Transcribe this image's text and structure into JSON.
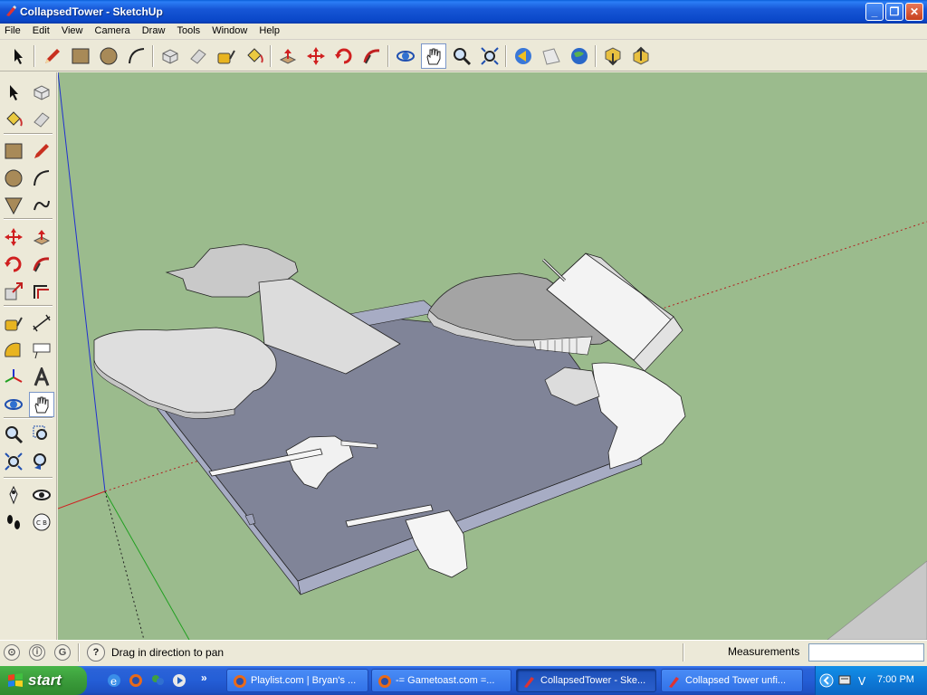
{
  "window": {
    "title": "CollapsedTower - SketchUp",
    "minimize_glyph": "_",
    "maximize_glyph": "❐",
    "close_glyph": "✕"
  },
  "menu": [
    "File",
    "Edit",
    "View",
    "Camera",
    "Draw",
    "Tools",
    "Window",
    "Help"
  ],
  "toolbar_icons": [
    "select-icon",
    "pencil-icon",
    "rectangle-icon",
    "circle-icon",
    "arc-icon",
    "make-component-icon",
    "eraser-icon",
    "tape-measure-icon",
    "paint-bucket-icon",
    "push-pull-icon",
    "move-icon",
    "rotate-icon",
    "follow-me-icon",
    "orbit-icon",
    "pan-icon",
    "zoom-icon",
    "zoom-extents-icon",
    "previous-view-icon",
    "next-view-icon",
    "google-earth-icon",
    "get-models-icon",
    "share-model-icon"
  ],
  "left_toolbar_icons": [
    "select-icon",
    "make-component-icon",
    "paint-bucket-icon",
    "eraser-icon",
    "rectangle-icon",
    "line-icon",
    "circle-icon",
    "arc-icon",
    "polygon-icon",
    "freehand-icon",
    "move-icon",
    "push-pull-icon",
    "rotate-icon",
    "follow-me-icon",
    "scale-icon",
    "offset-icon",
    "tape-measure-icon",
    "dimension-icon",
    "protractor-icon",
    "text-icon",
    "axes-icon",
    "3d-text-icon",
    "orbit-icon",
    "pan-icon",
    "zoom-icon",
    "zoom-window-icon",
    "zoom-extents-icon",
    "previous-icon",
    "position-camera-icon",
    "look-around-icon",
    "walk-icon",
    "section-plane-icon"
  ],
  "status": {
    "hint": "Drag in direction to pan",
    "measurements_label": "Measurements",
    "measurements_value": "",
    "help_glyph": "?"
  },
  "taskbar": {
    "start_label": "start",
    "more_glyph": "»",
    "tasks": [
      {
        "label": "Playlist.com | Bryan's ...",
        "icon": "firefox-icon",
        "active": false
      },
      {
        "label": "-= Gametoast.com =...",
        "icon": "firefox-icon",
        "active": false
      },
      {
        "label": "CollapsedTower - Ske...",
        "icon": "sketchup-icon",
        "active": true
      },
      {
        "label": "Collapsed Tower unfi...",
        "icon": "sketchup-icon",
        "active": false
      }
    ],
    "clock": "7:00 PM"
  },
  "colors": {
    "viewport_bg": "#9bbb8d",
    "slab_top": "#808498",
    "slab_side": "#a7acc4",
    "debris_light": "#f0f0f0",
    "debris_mid": "#c9c9c9",
    "debris_dark": "#a4a4a4"
  }
}
